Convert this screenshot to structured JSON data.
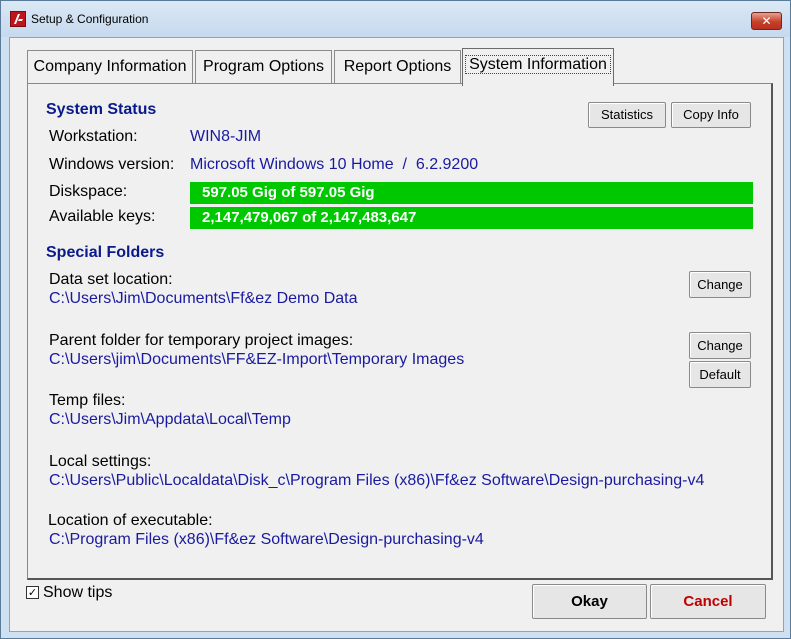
{
  "window": {
    "title": "Setup & Configuration",
    "close_glyph": "✕"
  },
  "tabs": [
    {
      "label": "Company Information",
      "active": false
    },
    {
      "label": "Program Options",
      "active": false
    },
    {
      "label": "Report Options",
      "active": false
    },
    {
      "label": "System Information",
      "active": true
    }
  ],
  "system_status": {
    "title": "System Status",
    "statistics_button": "Statistics",
    "copy_info_button": "Copy Info",
    "workstation_label": "Workstation:",
    "workstation_value": "WIN8-JIM",
    "windows_label": "Windows version:",
    "windows_value": "Microsoft Windows 10 Home  /  6.2.9200",
    "diskspace_label": "Diskspace:",
    "diskspace_value": "597.05 Gig of 597.05 Gig",
    "diskspace_fraction": 1.0,
    "keys_label": "Available keys:",
    "keys_value": "2,147,479,067 of 2,147,483,647",
    "keys_fraction": 1.0,
    "bar_color": "#00c800"
  },
  "special_folders": {
    "title": "Special Folders",
    "data_set_label": "Data set location:",
    "data_set_path": "C:\\Users\\Jim\\Documents\\Ff&ez Demo Data",
    "data_set_change": "Change",
    "parent_label": "Parent folder for temporary project images:",
    "parent_path": "C:\\Users\\jim\\Documents\\FF&EZ-Import\\Temporary Images",
    "parent_change": "Change",
    "parent_default": "Default",
    "temp_label": "Temp files:",
    "temp_path": "C:\\Users\\Jim\\Appdata\\Local\\Temp",
    "local_label": "Local settings:",
    "local_path": "C:\\Users\\Public\\Localdata\\Disk_c\\Program Files (x86)\\Ff&ez Software\\Design-purchasing-v4",
    "exe_label": "Location of executable:",
    "exe_path": "C:\\Program Files (x86)\\Ff&ez Software\\Design-purchasing-v4"
  },
  "footer": {
    "show_tips_label": "Show tips",
    "show_tips_checked": true,
    "check_glyph": "✓",
    "okay_button": "Okay",
    "cancel_button": "Cancel",
    "cancel_color": "#c00000"
  }
}
